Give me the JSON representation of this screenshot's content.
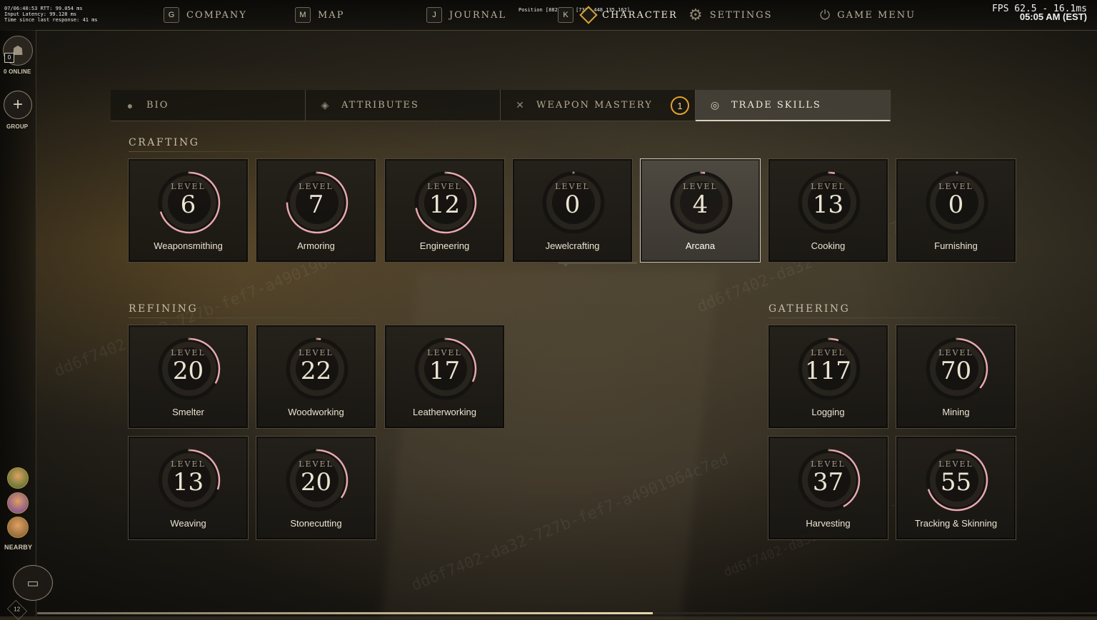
{
  "debug": {
    "net": "07/06:40:53 RTT: 99.054 ms\nInput Latency: 99.128 ms\nTime since last response: 41 ms",
    "position": "Position [882].078 [731].448 135.162]",
    "fps": "FPS 62.5 - 16.1ms",
    "clock": "05:05 AM (EST)"
  },
  "nav": [
    {
      "key": "G",
      "label": "COMPANY"
    },
    {
      "key": "M",
      "label": "MAP"
    },
    {
      "key": "J",
      "label": "JOURNAL"
    },
    {
      "key": "K",
      "label": "CHARACTER"
    },
    {
      "key": "",
      "label": "SETTINGS"
    },
    {
      "key": "",
      "label": "GAME MENU"
    }
  ],
  "rail": {
    "online_count": "0",
    "online_label": "0 ONLINE",
    "group_label": "GROUP",
    "nearby_label": "NEARBY",
    "player_level": "12"
  },
  "tabs": [
    {
      "label": "BIO",
      "icon": "bust-icon"
    },
    {
      "label": "ATTRIBUTES",
      "icon": "attribute-points-icon"
    },
    {
      "label": "WEAPON MASTERY",
      "icon": "crossed-swords-icon",
      "badge": "1"
    },
    {
      "label": "TRADE SKILLS",
      "icon": "compass-icon"
    }
  ],
  "sections": {
    "crafting": "CRAFTING",
    "refining": "REFINING",
    "gathering": "GATHERING"
  },
  "level_word": "LEVEL",
  "skills": {
    "crafting": [
      {
        "name": "Weaponsmithing",
        "level": "6",
        "progress": 0.7
      },
      {
        "name": "Armoring",
        "level": "7",
        "progress": 0.75
      },
      {
        "name": "Engineering",
        "level": "12",
        "progress": 0.72
      },
      {
        "name": "Jewelcrafting",
        "level": "0",
        "progress": 0.0
      },
      {
        "name": "Arcana",
        "level": "4",
        "progress": 0.02
      },
      {
        "name": "Cooking",
        "level": "13",
        "progress": 0.03
      },
      {
        "name": "Furnishing",
        "level": "0",
        "progress": 0.0
      }
    ],
    "refining": [
      {
        "name": "Smelter",
        "level": "20",
        "progress": 0.33
      },
      {
        "name": "Woodworking",
        "level": "22",
        "progress": 0.02
      },
      {
        "name": "Leatherworking",
        "level": "17",
        "progress": 0.32
      },
      {
        "name": "Weaving",
        "level": "13",
        "progress": 0.3
      },
      {
        "name": "Stonecutting",
        "level": "20",
        "progress": 0.35
      }
    ],
    "gathering": [
      {
        "name": "Logging",
        "level": "117",
        "progress": 0.05
      },
      {
        "name": "Mining",
        "level": "70",
        "progress": 0.36
      },
      {
        "name": "Harvesting",
        "level": "37",
        "progress": 0.42
      },
      {
        "name": "Tracking & Skinning",
        "level": "55",
        "progress": 0.7
      }
    ]
  },
  "colors": {
    "ring_progress": "#e8a9ae",
    "ring_track": "#151310",
    "badge_orange": "#e3a02e"
  },
  "watermark": "dd6f7402-da32-727b-fef7-a4901964c7ed"
}
